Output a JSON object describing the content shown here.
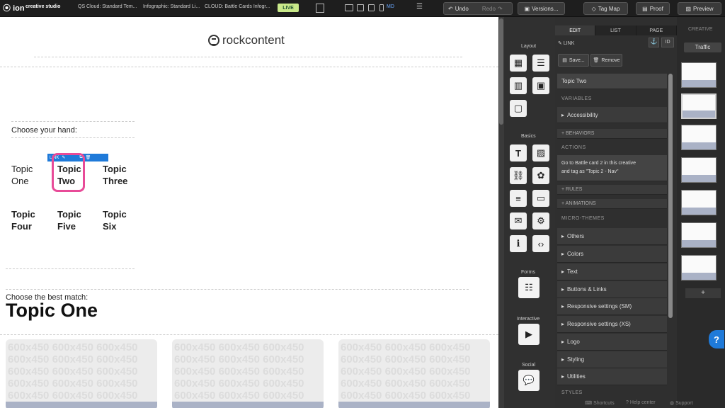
{
  "topbar": {
    "app_name": "creative studio",
    "logo_text": "ion",
    "breadcrumbs": [
      "QS Cloud: Standard Tem...",
      "Infographic: Standard Li...",
      "CLOUD: Battle Cards Infogr..."
    ],
    "live_badge": "LIVE",
    "device_label": "MD",
    "undo_label": "Undo",
    "redo_label": "Redo",
    "versions_label": "Versions...",
    "tagmap_label": "Tag Map",
    "proof_label": "Proof",
    "preview_label": "Preview"
  },
  "canvas": {
    "brand": "rockcontent",
    "choose_hand": "Choose your hand:",
    "topics": [
      {
        "line1": "Topic",
        "line2": "One"
      },
      {
        "line1": "Topic",
        "line2": "Two"
      },
      {
        "line1": "Topic",
        "line2": "Three"
      },
      {
        "line1": "Topic",
        "line2": "Four"
      },
      {
        "line1": "Topic",
        "line2": "Five"
      },
      {
        "line1": "Topic",
        "line2": "Six"
      }
    ],
    "link_tag": "LINK",
    "best_match": "Choose the best match:",
    "selected_topic": "Topic One",
    "placeholder": "600x450"
  },
  "tools": {
    "layout": "Layout",
    "basics": "Basics",
    "forms": "Forms",
    "interactive": "Interactive",
    "social": "Social"
  },
  "edit": {
    "tabs": [
      "EDIT",
      "LIST",
      "PAGE"
    ],
    "creative_tab": "CREATIVE",
    "element_type": "LINK",
    "id_label": "ID",
    "save_label": "Save...",
    "remove_label": "Remove",
    "element_name": "Topic Two",
    "variables_hdr": "VARIABLES",
    "accessibility": "Accessibility",
    "behaviors": "+ BEHAVIORS",
    "actions_hdr": "ACTIONS",
    "action_line1": "Go to Battle card 2 in this creative",
    "action_line2": "and tag as \"Topic 2 - Nav\"",
    "rules": "+ RULES",
    "animations": "+ ANIMATIONS",
    "microthemes_hdr": "MICRO-THEMES",
    "themes": [
      "Others",
      "Colors",
      "Text",
      "Buttons & Links",
      "Responsive settings (SM)",
      "Responsive settings (XS)",
      "Logo",
      "Styling",
      "Utilities"
    ],
    "styles_hdr": "STYLES"
  },
  "creative": {
    "traffic": "Traffic",
    "add": "+"
  },
  "footer": {
    "shortcuts": "Shortcuts",
    "help": "Help center",
    "support": "Support"
  },
  "colors": {
    "accent": "#1f7ad9",
    "highlight": "#e84b98",
    "live": "#c9e98a"
  }
}
